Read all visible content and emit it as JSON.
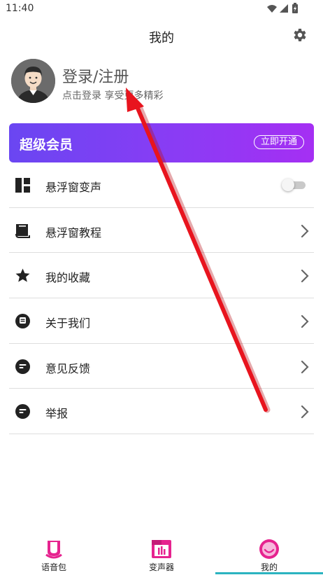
{
  "status_bar": {
    "time": "11:40"
  },
  "header": {
    "title": "我的"
  },
  "profile": {
    "title": "登录/注册",
    "subtitle": "点击登录 享受更多精彩"
  },
  "vip": {
    "title": "超级会员",
    "button": "立即开通"
  },
  "menu": {
    "items": [
      {
        "label": "悬浮窗变声",
        "icon": "grid-icon",
        "control": "toggle",
        "toggle_on": false
      },
      {
        "label": "悬浮窗教程",
        "icon": "book-icon",
        "control": "chevron"
      },
      {
        "label": "我的收藏",
        "icon": "star-icon",
        "control": "chevron"
      },
      {
        "label": "关于我们",
        "icon": "info-icon",
        "control": "chevron"
      },
      {
        "label": "意见反馈",
        "icon": "feedback-icon",
        "control": "chevron"
      },
      {
        "label": "举报",
        "icon": "report-icon",
        "control": "chevron"
      }
    ]
  },
  "bottom_nav": {
    "tabs": [
      {
        "label": "语音包",
        "icon": "voice-pack-icon"
      },
      {
        "label": "变声器",
        "icon": "voice-changer-icon"
      },
      {
        "label": "我的",
        "icon": "profile-face-icon",
        "active": true
      }
    ]
  },
  "colors": {
    "accent_pink": "#e6238f",
    "vip_gradient_start": "#6a46f2",
    "vip_gradient_end": "#a52ff3",
    "active_indicator": "#2bb3c0",
    "annotation_arrow": "#e8141e"
  }
}
